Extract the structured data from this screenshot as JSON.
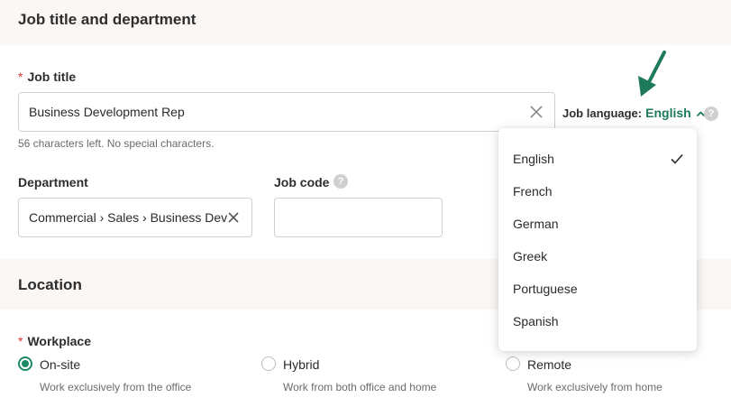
{
  "sections": {
    "job": {
      "title": "Job title and department"
    },
    "location": {
      "title": "Location"
    }
  },
  "job_title": {
    "required_marker": "*",
    "label": "Job title",
    "value": "Business Development Rep",
    "hint": "56 characters left. No special characters."
  },
  "job_language": {
    "label": "Job language:",
    "value": "English",
    "help": "?",
    "options": [
      {
        "label": "English",
        "selected": true
      },
      {
        "label": "French",
        "selected": false
      },
      {
        "label": "German",
        "selected": false
      },
      {
        "label": "Greek",
        "selected": false
      },
      {
        "label": "Portuguese",
        "selected": false
      },
      {
        "label": "Spanish",
        "selected": false
      }
    ]
  },
  "department": {
    "label": "Department",
    "value": "Commercial › Sales › Business Dev"
  },
  "job_code": {
    "label": "Job code",
    "value": "",
    "help": "?"
  },
  "workplace": {
    "required_marker": "*",
    "label": "Workplace",
    "options": [
      {
        "label": "On-site",
        "description": "Work exclusively from the office",
        "selected": true
      },
      {
        "label": "Hybrid",
        "description": "Work from both office and home",
        "selected": false
      },
      {
        "label": "Remote",
        "description": "Work exclusively from home",
        "selected": false
      }
    ]
  },
  "colors": {
    "accent": "#1d8a64",
    "link": "#1d7a5a",
    "required": "#d9322b",
    "section_bg": "#faf7f4",
    "annotation_arrow": "#1f7a5c"
  },
  "icons": {
    "clear": "close-icon",
    "help": "help-circle-icon",
    "chevron": "chevron-up-icon",
    "check": "checkmark-icon",
    "annotation": "arrow-down-icon"
  }
}
